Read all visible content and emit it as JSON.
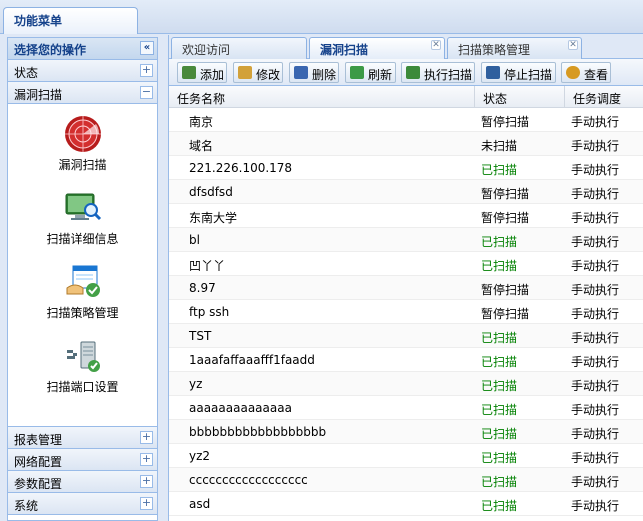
{
  "top_tab": "功能菜单",
  "sidebar": {
    "header": "选择您的操作",
    "collapse_glyph": "«",
    "sections_top": [
      {
        "label": "状态",
        "sign": "+"
      },
      {
        "label": "漏洞扫描",
        "sign": "−"
      }
    ],
    "nav": [
      {
        "label": "漏洞扫描",
        "icon": "radar-icon"
      },
      {
        "label": "扫描详细信息",
        "icon": "monitor-search-icon"
      },
      {
        "label": "扫描策略管理",
        "icon": "policy-check-icon"
      },
      {
        "label": "扫描端口设置",
        "icon": "server-port-icon"
      }
    ],
    "sections_bottom": [
      {
        "label": "报表管理",
        "sign": "+"
      },
      {
        "label": "网络配置",
        "sign": "+"
      },
      {
        "label": "参数配置",
        "sign": "+"
      },
      {
        "label": "系统",
        "sign": "+"
      }
    ]
  },
  "tabs": [
    {
      "label": "欢迎访问",
      "closable": false
    },
    {
      "label": "漏洞扫描",
      "closable": true
    },
    {
      "label": "扫描策略管理",
      "closable": true
    }
  ],
  "toolbar": [
    {
      "label": "添加",
      "icon": "add-icon",
      "color": "#4a8a3c"
    },
    {
      "label": "修改",
      "icon": "edit-icon",
      "color": "#d2a13a"
    },
    {
      "label": "删除",
      "icon": "delete-icon",
      "color": "#3a66b0"
    },
    {
      "label": "刷新",
      "icon": "refresh-icon",
      "color": "#3c9a46"
    },
    {
      "label": "执行扫描",
      "icon": "run-scan-icon",
      "color": "#3c8a3a"
    },
    {
      "label": "停止扫描",
      "icon": "stop-scan-icon",
      "color": "#2f5f9e"
    },
    {
      "label": "查看",
      "icon": "view-icon",
      "color": "#d79a22"
    }
  ],
  "grid": {
    "columns": [
      "任务名称",
      "状态",
      "任务调度"
    ],
    "rows": [
      {
        "name": "南京",
        "status": "暂停扫描",
        "schedule": "手动执行",
        "green": false
      },
      {
        "name": "域名",
        "status": "未扫描",
        "schedule": "手动执行",
        "green": false
      },
      {
        "name": "221.226.100.178",
        "status": "已扫描",
        "schedule": "手动执行",
        "green": true
      },
      {
        "name": "dfsdfsd",
        "status": "暂停扫描",
        "schedule": "手动执行",
        "green": false
      },
      {
        "name": "东南大学",
        "status": "暂停扫描",
        "schedule": "手动执行",
        "green": false
      },
      {
        "name": "bl",
        "status": "已扫描",
        "schedule": "手动执行",
        "green": true
      },
      {
        "name": "凹丫丫",
        "status": "已扫描",
        "schedule": "手动执行",
        "green": true
      },
      {
        "name": "8.97",
        "status": "暂停扫描",
        "schedule": "手动执行",
        "green": false
      },
      {
        "name": "ftp ssh",
        "status": "暂停扫描",
        "schedule": "手动执行",
        "green": false
      },
      {
        "name": "TST",
        "status": "已扫描",
        "schedule": "手动执行",
        "green": true
      },
      {
        "name": "1aaafaffaaafff1faadd",
        "status": "已扫描",
        "schedule": "手动执行",
        "green": true
      },
      {
        "name": "yz",
        "status": "已扫描",
        "schedule": "手动执行",
        "green": true
      },
      {
        "name": "aaaaaaaaaaaaaa",
        "status": "已扫描",
        "schedule": "手动执行",
        "green": true
      },
      {
        "name": "bbbbbbbbbbbbbbbbbb",
        "status": "已扫描",
        "schedule": "手动执行",
        "green": true
      },
      {
        "name": "yz2",
        "status": "已扫描",
        "schedule": "手动执行",
        "green": true
      },
      {
        "name": "cccccccccccccccccc",
        "status": "已扫描",
        "schedule": "手动执行",
        "green": true
      },
      {
        "name": "asd",
        "status": "已扫描",
        "schedule": "手动执行",
        "green": true
      }
    ]
  },
  "colors": {
    "status_done": "#008000",
    "title_blue": "#15428b",
    "border": "#99bbe8"
  }
}
